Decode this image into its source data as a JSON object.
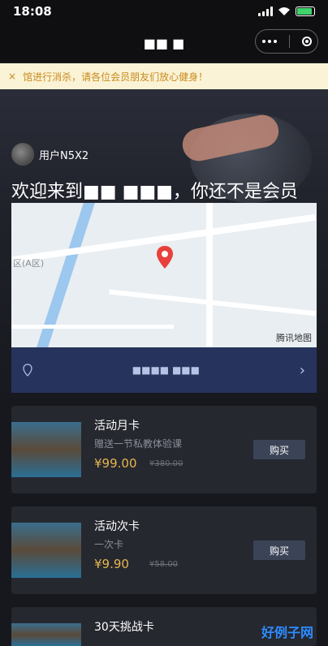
{
  "status": {
    "time": "18:08"
  },
  "topbar": {
    "title": "■■ ■"
  },
  "notice": {
    "close": "×",
    "text": "馆进行消杀，请各位会员朋友们放心健身！"
  },
  "user": {
    "name": "用户N5X2"
  },
  "welcome": {
    "text": "欢迎来到■■ ■■■，你还不是会员"
  },
  "map": {
    "area": "区(A区)",
    "logo": "腾讯地图"
  },
  "address": {
    "text": "■■■■  ■■■"
  },
  "cards": [
    {
      "name": "活动月卡",
      "desc": "赠送一节私教体验课",
      "price": "¥99.00",
      "original": "¥380.00",
      "button": "购买"
    },
    {
      "name": "活动次卡",
      "desc": "一次卡",
      "price": "¥9.90",
      "original": "¥58.00",
      "button": "购买"
    },
    {
      "name": "30天挑战卡",
      "desc": "",
      "price": "",
      "original": "",
      "button": ""
    }
  ],
  "watermark": "好例子网"
}
